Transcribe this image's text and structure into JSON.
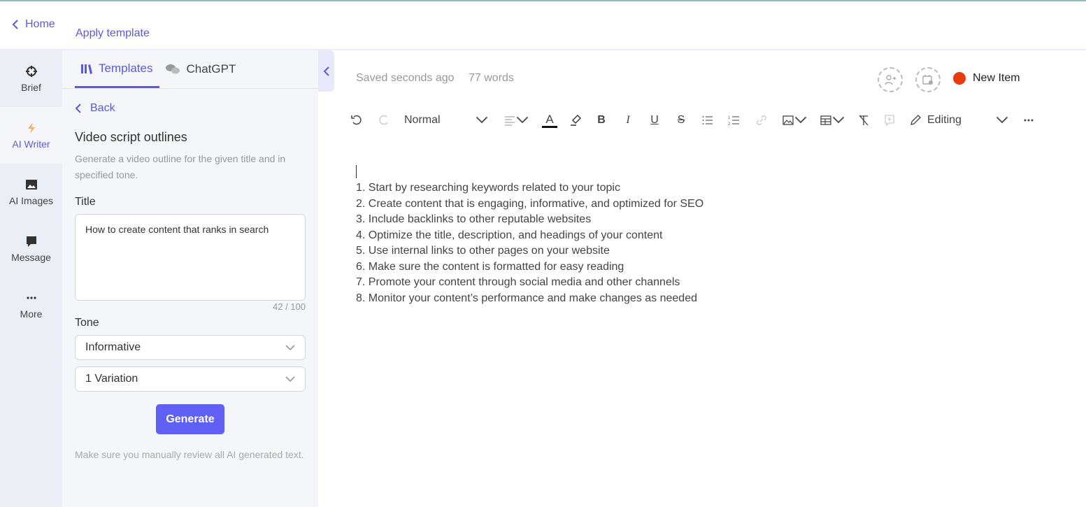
{
  "header": {
    "home_label": "Home",
    "apply_template": "Apply template"
  },
  "rail": {
    "items": [
      {
        "label": "Brief",
        "icon": "crosshair-icon"
      },
      {
        "label": "AI Writer",
        "icon": "lightning-icon",
        "active": true
      },
      {
        "label": "AI Images",
        "icon": "image-icon"
      },
      {
        "label": "Message",
        "icon": "message-icon"
      },
      {
        "label": "More",
        "icon": "more-icon"
      }
    ]
  },
  "panel": {
    "tabs": [
      {
        "label": "Templates",
        "active": true
      },
      {
        "label": "ChatGPT"
      }
    ],
    "back": "Back",
    "title": "Video script outlines",
    "description": "Generate a video outline for the given title and in specified tone.",
    "title_label": "Title",
    "title_value": "How to create content that ranks in search",
    "char_count": "42 / 100",
    "tone_label": "Tone",
    "tone_value": "Informative",
    "variation_value": "1 Variation",
    "generate": "Generate",
    "note": "Make sure you manually review all AI generated text."
  },
  "editor": {
    "saved": "Saved seconds ago",
    "words": "77 words",
    "new_item": "New Item",
    "status_color": "#e83a0c",
    "accent": "#5b5bd6",
    "toolbar": {
      "style": "Normal",
      "mode": "Editing"
    },
    "lines": [
      "1. Start by researching keywords related to your topic",
      "2. Create content that is engaging, informative, and optimized for SEO",
      "3. Include backlinks to other reputable websites",
      "4. Optimize the title, description, and headings of your content",
      "5. Use internal links to other pages on your website",
      "6. Make sure the content is formatted for easy reading",
      "7. Promote your content through social media and other channels",
      "8. Monitor your content’s performance and make changes as needed"
    ]
  }
}
